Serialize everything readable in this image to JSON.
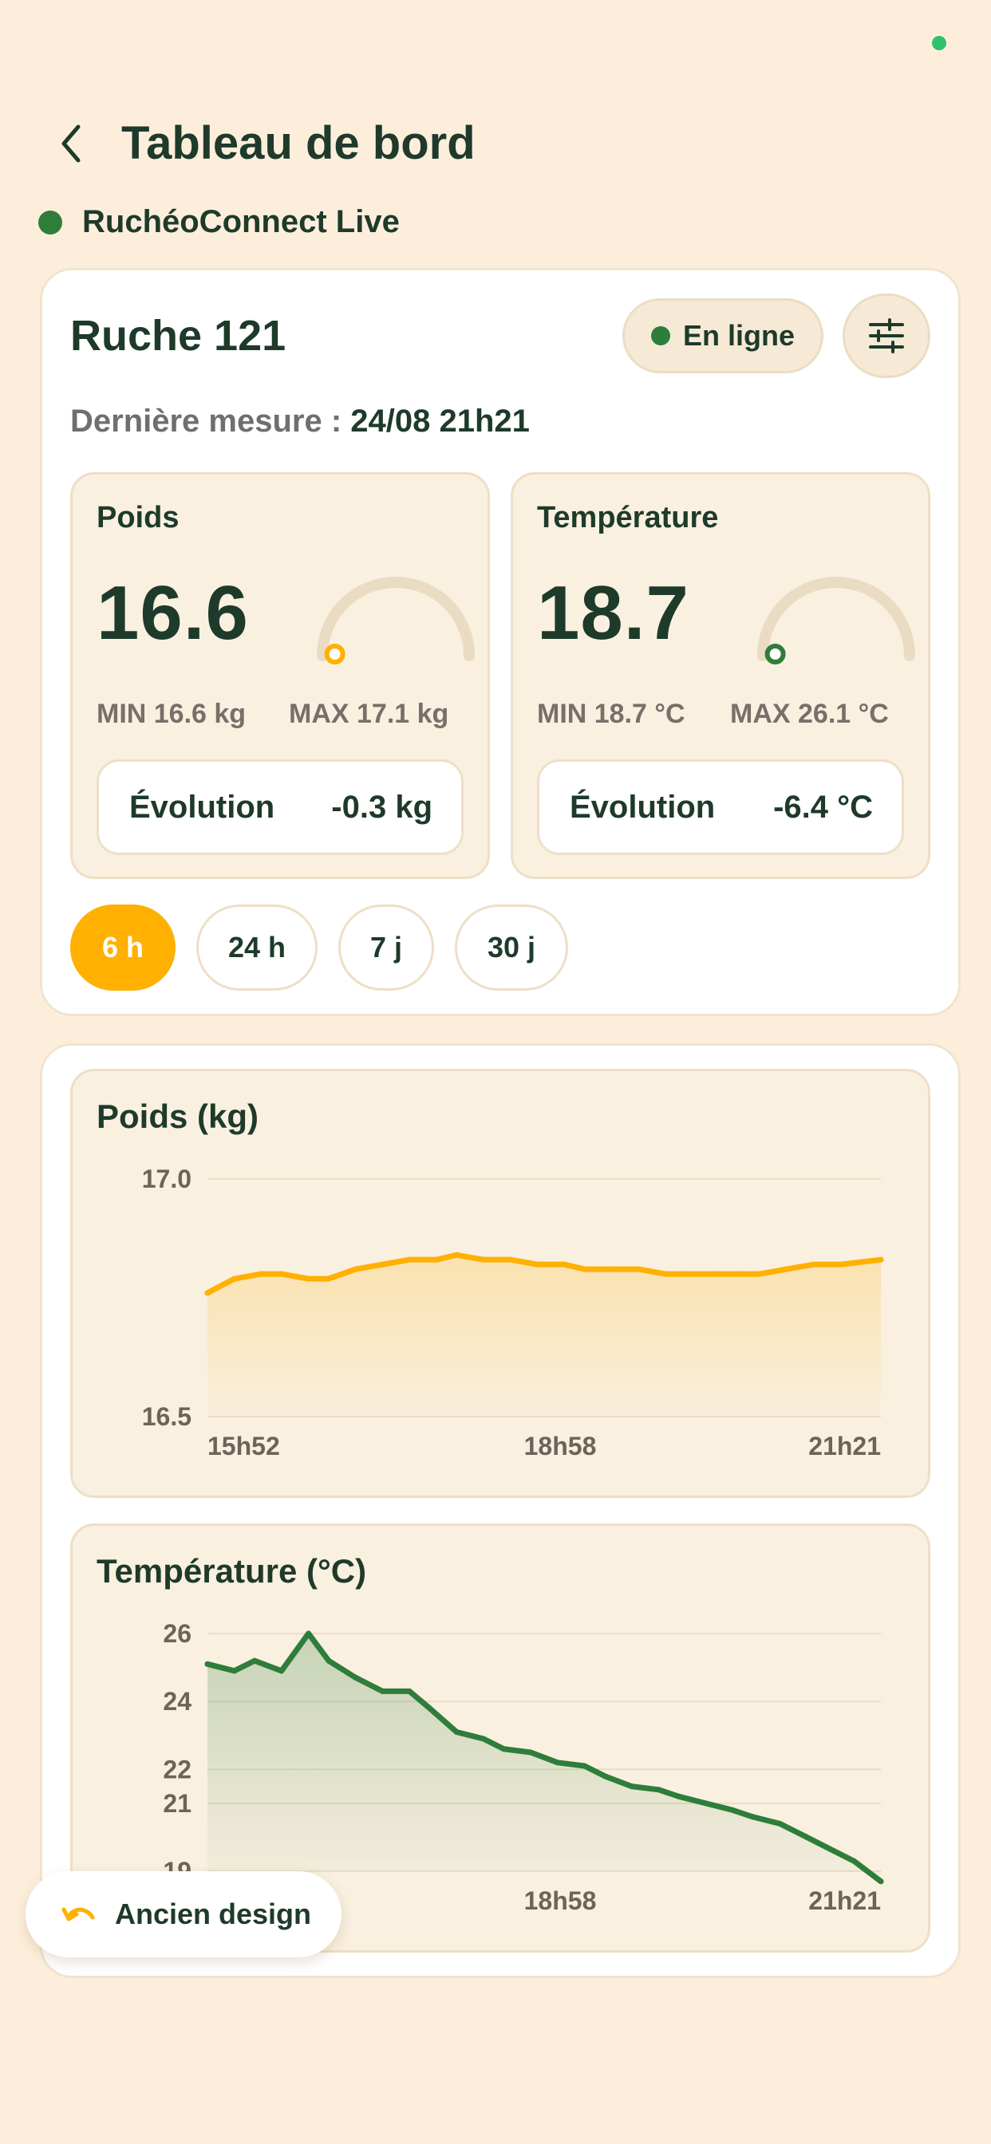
{
  "header": {
    "title": "Tableau de bord",
    "live_label": "RuchéoConnect Live"
  },
  "hive": {
    "name": "Ruche 121",
    "status_label": "En ligne",
    "last_measure_label": "Dernière mesure :",
    "last_measure_value": "24/08 21h21"
  },
  "metrics": {
    "weight": {
      "title": "Poids",
      "value": "16.6",
      "min": "MIN 16.6 kg",
      "max": "MAX 17.1 kg",
      "evolution_label": "Évolution",
      "evolution_value": "-0.3 kg",
      "gauge_fraction": 0.0,
      "gauge_color": "#FFB000"
    },
    "temperature": {
      "title": "Température",
      "value": "18.7",
      "min": "MIN 18.7 °C",
      "max": "MAX 26.1 °C",
      "evolution_label": "Évolution",
      "evolution_value": "-6.4 °C",
      "gauge_fraction": 0.0,
      "gauge_color": "#2E7D3A"
    }
  },
  "periods": {
    "active": "6 h",
    "items": [
      "6 h",
      "24 h",
      "7 j",
      "30 j"
    ]
  },
  "charts": {
    "weight": {
      "title": "Poids (kg)"
    },
    "temperature": {
      "title": "Température (°C)"
    }
  },
  "footer": {
    "old_design_label": "Ancien design"
  },
  "colors": {
    "accent": "#FFB000",
    "green": "#2E7D3A",
    "background": "#FDEEDC"
  },
  "icons": [
    "back-arrow-icon",
    "sliders-icon",
    "undo-icon"
  ],
  "chart_data": [
    {
      "type": "area",
      "title": "Poids (kg)",
      "xlabel": "",
      "ylabel": "",
      "x_ticks": [
        "15h52",
        "18h58",
        "21h21"
      ],
      "y_ticks": [
        "17.0",
        "16.5"
      ],
      "ylim": [
        16.5,
        17.0
      ],
      "x": [
        0,
        0.04,
        0.08,
        0.11,
        0.15,
        0.18,
        0.22,
        0.26,
        0.3,
        0.34,
        0.37,
        0.41,
        0.45,
        0.49,
        0.53,
        0.56,
        0.6,
        0.64,
        0.68,
        0.71,
        0.75,
        0.79,
        0.82,
        0.86,
        0.9,
        0.94,
        1.0
      ],
      "values": [
        16.76,
        16.79,
        16.8,
        16.8,
        16.79,
        16.79,
        16.81,
        16.82,
        16.83,
        16.83,
        16.84,
        16.83,
        16.83,
        16.82,
        16.82,
        16.81,
        16.81,
        16.81,
        16.8,
        16.8,
        16.8,
        16.8,
        16.8,
        16.81,
        16.82,
        16.82,
        16.83
      ],
      "color": "#FFB000",
      "grid": true
    },
    {
      "type": "area",
      "title": "Température (°C)",
      "xlabel": "",
      "ylabel": "",
      "x_ticks": [
        "15h52",
        "18h58",
        "21h21"
      ],
      "y_ticks": [
        "26",
        "24",
        "22",
        "21",
        "19"
      ],
      "ylim": [
        19,
        26
      ],
      "x": [
        0,
        0.04,
        0.07,
        0.11,
        0.15,
        0.18,
        0.22,
        0.26,
        0.3,
        0.33,
        0.37,
        0.41,
        0.44,
        0.48,
        0.52,
        0.56,
        0.59,
        0.63,
        0.67,
        0.7,
        0.74,
        0.78,
        0.81,
        0.85,
        0.89,
        0.93,
        0.96,
        1.0
      ],
      "values": [
        25.1,
        24.9,
        25.2,
        24.9,
        26.0,
        25.2,
        24.7,
        24.3,
        24.3,
        23.8,
        23.1,
        22.9,
        22.6,
        22.5,
        22.2,
        22.1,
        21.8,
        21.5,
        21.4,
        21.2,
        21.0,
        20.8,
        20.6,
        20.4,
        20.0,
        19.6,
        19.3,
        18.7
      ],
      "color": "#2E7D3A",
      "grid": true
    }
  ]
}
